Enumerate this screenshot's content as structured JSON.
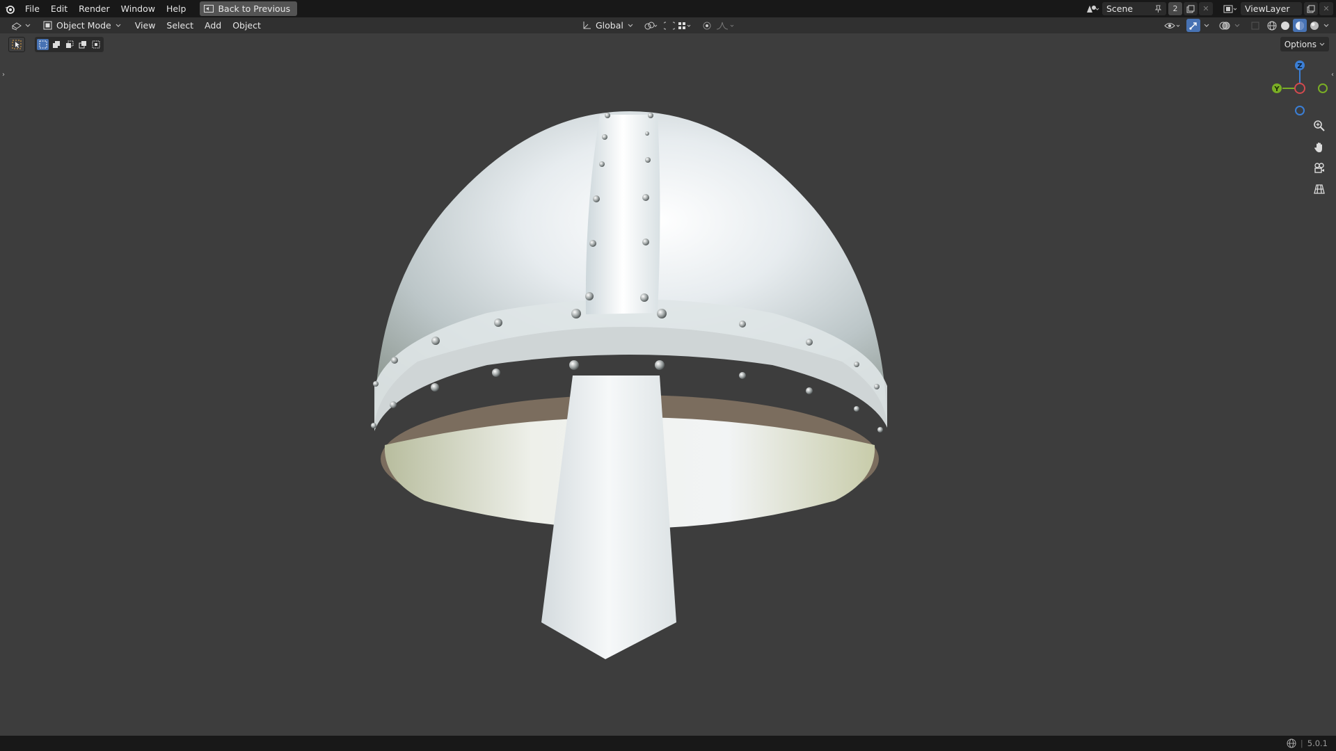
{
  "topbar": {
    "menu": [
      "File",
      "Edit",
      "Render",
      "Window",
      "Help"
    ],
    "back_label": "Back to Previous",
    "scene_label": "Scene",
    "scene_users": "2",
    "view_layer_label": "ViewLayer"
  },
  "header": {
    "mode_label": "Object Mode",
    "menu": [
      "View",
      "Select",
      "Add",
      "Object"
    ],
    "transform_orientation": "Global"
  },
  "options_label": "Options",
  "gizmo": {
    "z": "Z",
    "y": "Y"
  },
  "status": {
    "version": "5.0.1"
  },
  "colors": {
    "accent": "#4772b3",
    "axis_x": "#d44a4f",
    "axis_y": "#7aae25",
    "axis_z": "#3b7fd6",
    "viewport_bg": "#3d3d3d"
  },
  "icons": [
    "blender-logo-icon",
    "back-screen-icon",
    "editor-type-icon",
    "object-mode-icon",
    "transform-orientation-icon",
    "pivot-icon",
    "snap-icon",
    "proportional-edit-icon",
    "visibility-icon",
    "gizmo-icon",
    "overlay-icon",
    "xray-icon",
    "wireframe-shading-icon",
    "solid-shading-icon",
    "material-shading-icon",
    "rendered-shading-icon",
    "zoom-icon",
    "pan-hand-icon",
    "camera-view-icon",
    "orthographic-grid-icon",
    "network-icon"
  ]
}
